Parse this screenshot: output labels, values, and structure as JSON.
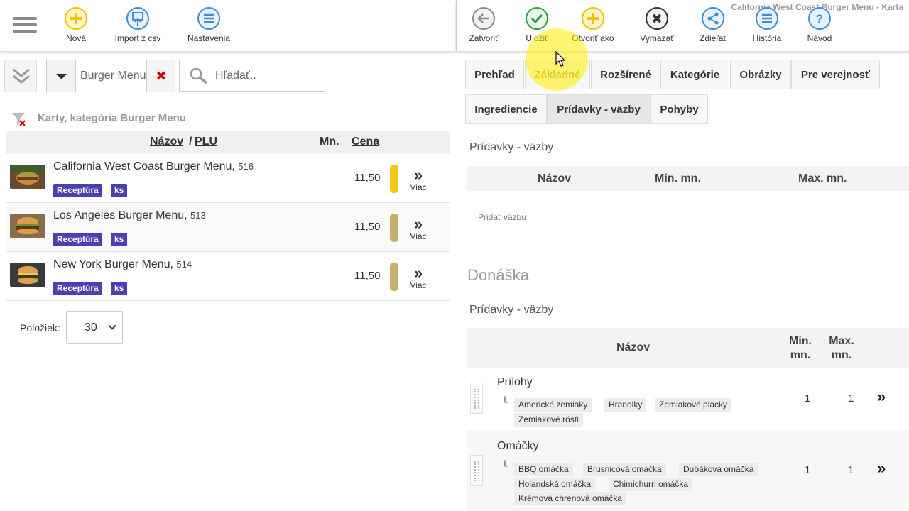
{
  "window_title": "California West Coast Burger Menu - Karta",
  "left_toolbar": {
    "buttons": [
      {
        "label": "Nová",
        "icon": "plus-circle-icon"
      },
      {
        "label": "Import z csv",
        "icon": "import-icon"
      },
      {
        "label": "Nastavenia",
        "icon": "menu-lines-icon"
      }
    ]
  },
  "right_toolbar": {
    "buttons": [
      {
        "label": "Zatvoriť",
        "icon": "arrow-left-icon"
      },
      {
        "label": "Uložiť",
        "icon": "check-icon"
      },
      {
        "label": "Otvoriť ako",
        "icon": "plus-circle-icon"
      },
      {
        "label": "Vymazať",
        "icon": "delete-x-icon"
      },
      {
        "label": "Zdieľať",
        "icon": "share-icon"
      },
      {
        "label": "História",
        "icon": "menu-lines-icon"
      },
      {
        "label": "Návod",
        "icon": "question-icon"
      }
    ]
  },
  "filter": {
    "value": "Burger Menu"
  },
  "search": {
    "placeholder": "Hľadať.."
  },
  "list": {
    "heading": "Karty, kategória Burger Menu",
    "col_name": "Názov",
    "col_sep": "/",
    "col_plu": "PLU",
    "col_qty": "Mn.",
    "col_price": "Cena",
    "more_label": "Viac",
    "items": [
      {
        "name": "California West Coast Burger Menu",
        "plu": "516",
        "badge1": "Receptúra",
        "badge2": "ks",
        "price": "11,50",
        "bar_color": "#f5c518"
      },
      {
        "name": "Los Angeles Burger Menu",
        "plu": "513",
        "badge1": "Receptúra",
        "badge2": "ks",
        "price": "11,50",
        "bar_color": "#c9b06a"
      },
      {
        "name": "New York Burger Menu",
        "plu": "514",
        "badge1": "Receptúra",
        "badge2": "ks",
        "price": "11,50",
        "bar_color": "#c9b06a"
      }
    ]
  },
  "pager": {
    "label": "Položiek:",
    "value": "30"
  },
  "tabs": {
    "row1": [
      "Prehľad",
      "Základné",
      "Rozšírené",
      "Kategórie",
      "Obrázky",
      "Pre verejnosť"
    ],
    "row2": [
      "Ingrediencie",
      "Prídavky - väzby",
      "Pohyby"
    ]
  },
  "addons": {
    "label": "Prídavky - väzby",
    "col_name": "Názov",
    "col_min": "Min. mn.",
    "col_max": "Max. mn.",
    "add_link": "Pridať väzbu"
  },
  "delivery": {
    "heading": "Donáška",
    "label": "Prídavky - väzby",
    "col_name": "Názov",
    "col_min": "Min. mn.",
    "col_max": "Max. mn.",
    "groups": [
      {
        "name": "Prílohy",
        "min": "1",
        "max": "1",
        "items": [
          "Americké zemiaky",
          "Hranolky",
          "Zemiakové placky",
          "Zemiakové rösti"
        ]
      },
      {
        "name": "Omáčky",
        "min": "1",
        "max": "1",
        "items": [
          "BBQ omáčka",
          "Brusnicová omáčka",
          "Dubáková omáčka",
          "Holandská omáčka",
          "Chimichurri omáčka",
          "Krémová chrenová omáčka"
        ]
      }
    ]
  },
  "colors": {
    "badge": "#4b3fb5",
    "accent_yellow": "#f5c518",
    "icon_blue": "#3a8fd6",
    "check_green": "#2ea043"
  }
}
